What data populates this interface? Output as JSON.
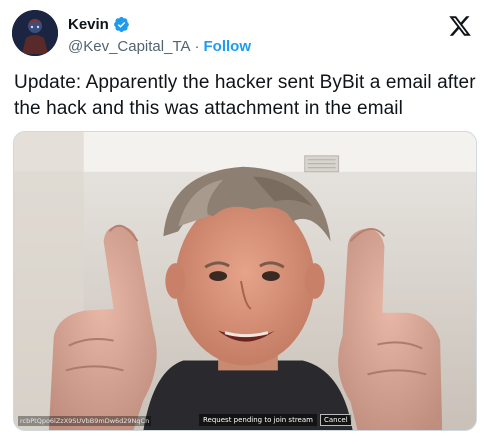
{
  "author": {
    "display_name": "Kevin",
    "handle": "@Kev_Capital_TA",
    "separator": "·",
    "follow_label": "Follow",
    "verified": true,
    "avatar_icon": "avatar-icon",
    "accent_color": "#1d9bf0"
  },
  "brand": {
    "logo": "x-logo-icon"
  },
  "tweet": {
    "text": "Update: Apparently the hacker sent ByBit a email after the hack and this was attachment in the email"
  },
  "media": {
    "stream_id": "rcbPtQpo6lZzX9SUVbB9mDw6d29NqCn",
    "pending_text": "Request pending to join stream",
    "cancel_label": "Cancel"
  }
}
